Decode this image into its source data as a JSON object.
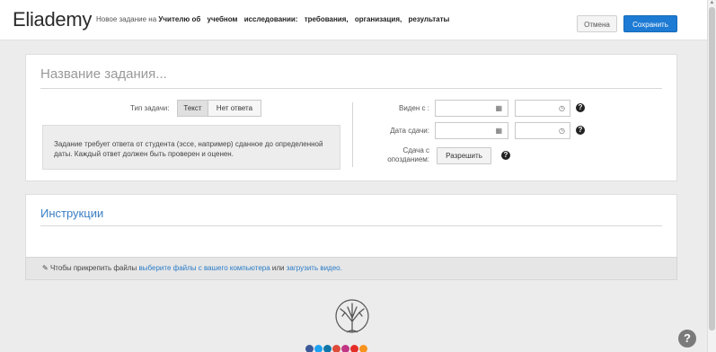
{
  "header": {
    "logo": "Eliademy",
    "title_prefix": "Новое задание на",
    "title_course_words": [
      "Учителю",
      "об",
      "учебном",
      "исследовании:",
      "требования,",
      "организация,",
      "результаты"
    ],
    "cancel_label": "Отмена",
    "save_label": "Сохранить"
  },
  "task": {
    "title_placeholder": "Название задания...",
    "type_label": "Тип задачи:",
    "type_options": [
      "Текст",
      "Нет ответа"
    ],
    "type_selected": "Текст",
    "description": "Задание требует ответа от студента (эссе, например) сданное до определенной даты. Каждый ответ должен быть проверен и оценен.",
    "visible_from_label": "Виден с :",
    "due_date_label": "Дата сдачи:",
    "late_label_line1": "Сдача с",
    "late_label_line2": "опозданием:",
    "allow_label": "Разрешить",
    "help_glyph": "?"
  },
  "instructions": {
    "title": "Инструкции",
    "attach_prefix": "Чтобы прикрепить файлы",
    "attach_link_files": "выберите файлы с вашего компьютера",
    "attach_or": "или",
    "attach_link_video": "загрузить видео."
  },
  "footer": {
    "social_icons": [
      "facebook-icon",
      "twitter-icon",
      "linkedin-icon",
      "googleplus-icon",
      "instagram-icon",
      "youtube-icon",
      "rss-icon"
    ],
    "social_colors": [
      "#3b5998",
      "#1da1f2",
      "#0e76a8",
      "#dd4b39",
      "#c13584",
      "#e52d27",
      "#f7931e"
    ],
    "help_glyph": "?"
  },
  "colors": {
    "accent": "#1d7bd4",
    "link": "#2a7cc7",
    "background": "#ececec"
  }
}
